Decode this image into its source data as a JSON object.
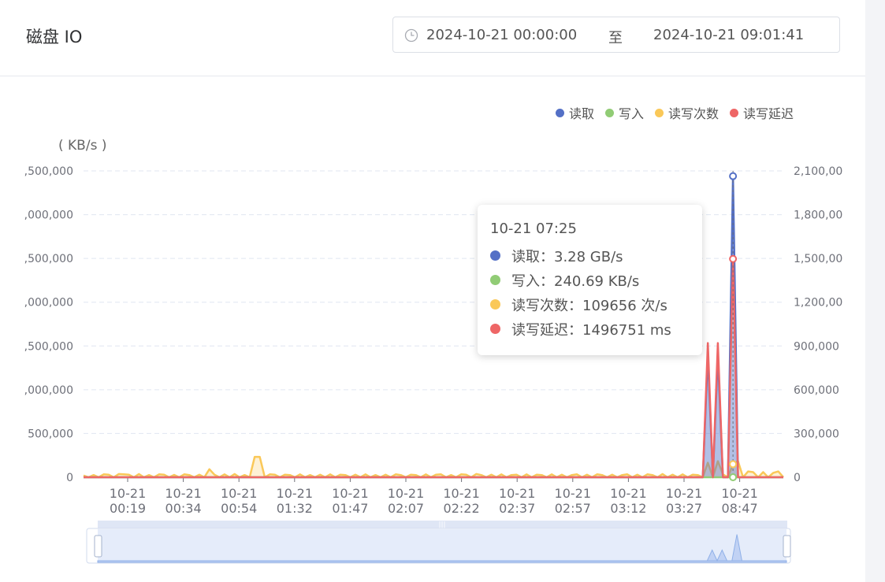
{
  "page": {
    "title": "磁盘 IO",
    "range": {
      "start": "2024-10-21 00:00:00",
      "separator": "至",
      "end": "2024-10-21 09:01:41"
    }
  },
  "legend": [
    {
      "label": "读取",
      "color": "#5470c6"
    },
    {
      "label": "写入",
      "color": "#91cc75"
    },
    {
      "label": "读写次数",
      "color": "#fac858"
    },
    {
      "label": "读写延迟",
      "color": "#ee6666"
    }
  ],
  "tooltip": {
    "title": "10-21 07:25",
    "rows": [
      {
        "label": "读取：3.28 GB/s",
        "color": "#5470c6"
      },
      {
        "label": "写入：240.69 KB/s",
        "color": "#91cc75"
      },
      {
        "label": "读写次数：109656 次/s",
        "color": "#fac858"
      },
      {
        "label": "读写延迟：1496751 ms",
        "color": "#ee6666"
      }
    ]
  },
  "chart_data": {
    "type": "line",
    "y_unit_label": "( KB/s )",
    "left_axis": {
      "ticks": [
        ",500,000",
        ",000,000",
        ",500,000",
        ",000,000",
        ",500,000",
        ",000,000",
        "500,000",
        "0"
      ],
      "range": [
        0,
        3500000
      ]
    },
    "right_axis": {
      "ticks": [
        "2,100,00",
        "1,800,00",
        "1,500,00",
        "1,200,00",
        "900,000",
        "600,000",
        "300,000",
        "0"
      ],
      "range": [
        0,
        2100000
      ]
    },
    "x_ticks": [
      {
        "line1": "10-21",
        "line2": "00:19"
      },
      {
        "line1": "10-21",
        "line2": "00:34"
      },
      {
        "line1": "10-21",
        "line2": "00:54"
      },
      {
        "line1": "10-21",
        "line2": "01:32"
      },
      {
        "line1": "10-21",
        "line2": "01:47"
      },
      {
        "line1": "10-21",
        "line2": "02:07"
      },
      {
        "line1": "10-21",
        "line2": "02:22"
      },
      {
        "line1": "10-21",
        "line2": "02:37"
      },
      {
        "line1": "10-21",
        "line2": "02:57"
      },
      {
        "line1": "10-21",
        "line2": "03:12"
      },
      {
        "line1": "10-21",
        "line2": "03:27"
      },
      {
        "line1": "10-21",
        "line2": "08:47"
      }
    ],
    "grid": true,
    "legend_position": "top-right",
    "series": [
      {
        "name": "读取",
        "axis": "left",
        "color": "#5470c6",
        "area": true,
        "values": [
          0,
          0,
          0,
          0,
          0,
          0,
          0,
          0,
          0,
          0,
          0,
          0,
          0,
          0,
          0,
          0,
          0,
          0,
          0,
          0,
          0,
          0,
          0,
          0,
          0,
          0,
          0,
          0,
          0,
          0,
          0,
          0,
          0,
          0,
          0,
          0,
          0,
          0,
          0,
          0,
          0,
          0,
          0,
          0,
          0,
          0,
          0,
          0,
          0,
          0,
          0,
          0,
          0,
          0,
          0,
          0,
          0,
          0,
          0,
          0,
          0,
          0,
          0,
          0,
          0,
          0,
          0,
          0,
          0,
          0,
          0,
          0,
          0,
          0,
          0,
          0,
          0,
          0,
          0,
          0,
          0,
          0,
          0,
          0,
          0,
          0,
          0,
          0,
          0,
          0,
          0,
          0,
          0,
          0,
          0,
          0,
          0,
          0,
          0,
          0,
          0,
          0,
          0,
          0,
          0,
          0,
          0,
          0,
          0,
          0,
          0,
          0,
          0,
          0,
          0,
          0,
          0,
          0,
          0,
          0,
          0,
          0,
          0,
          0,
          1400000,
          0,
          1400000,
          0,
          0,
          3440000,
          0,
          0,
          0,
          0,
          0,
          0,
          0,
          0,
          0,
          0
        ]
      },
      {
        "name": "写入",
        "axis": "left",
        "color": "#91cc75",
        "area": false,
        "values": [
          0,
          0,
          0,
          0,
          0,
          0,
          0,
          0,
          0,
          0,
          0,
          0,
          0,
          0,
          0,
          0,
          0,
          0,
          0,
          0,
          0,
          0,
          0,
          0,
          0,
          0,
          0,
          0,
          0,
          0,
          0,
          0,
          0,
          0,
          0,
          0,
          0,
          0,
          0,
          0,
          0,
          0,
          0,
          0,
          0,
          0,
          0,
          0,
          0,
          0,
          0,
          0,
          0,
          0,
          0,
          0,
          0,
          0,
          0,
          0,
          0,
          0,
          0,
          0,
          0,
          0,
          0,
          0,
          0,
          0,
          0,
          0,
          0,
          0,
          0,
          0,
          0,
          0,
          0,
          0,
          0,
          0,
          0,
          0,
          0,
          0,
          0,
          0,
          0,
          0,
          0,
          0,
          0,
          0,
          0,
          0,
          0,
          0,
          0,
          0,
          0,
          0,
          0,
          0,
          0,
          0,
          0,
          0,
          0,
          0,
          0,
          0,
          0,
          0,
          0,
          0,
          0,
          0,
          0,
          0,
          0,
          0,
          0,
          0,
          0,
          0,
          0,
          0,
          0,
          0,
          0,
          0,
          0,
          0,
          0,
          0,
          0,
          0,
          0,
          0
        ]
      },
      {
        "name": "读写次数",
        "axis": "right",
        "color": "#fac858",
        "area": true,
        "values": [
          12000,
          0,
          15000,
          0,
          20000,
          18000,
          0,
          22000,
          20000,
          18000,
          0,
          22000,
          0,
          15000,
          0,
          20000,
          18000,
          0,
          16000,
          0,
          20000,
          15000,
          0,
          18000,
          0,
          55000,
          18000,
          0,
          20000,
          0,
          22000,
          0,
          15000,
          0,
          140000,
          140000,
          0,
          20000,
          18000,
          0,
          18000,
          15000,
          0,
          20000,
          0,
          15000,
          0,
          18000,
          0,
          20000,
          0,
          18000,
          15000,
          0,
          18000,
          0,
          20000,
          0,
          15000,
          0,
          18000,
          0,
          20000,
          15000,
          0,
          18000,
          15000,
          0,
          20000,
          0,
          18000,
          20000,
          0,
          15000,
          0,
          20000,
          18000,
          0,
          22000,
          15000,
          0,
          18000,
          0,
          20000,
          0,
          15000,
          18000,
          0,
          20000,
          0,
          18000,
          15000,
          0,
          20000,
          0,
          18000,
          0,
          15000,
          20000,
          0,
          18000,
          0,
          20000,
          15000,
          0,
          18000,
          0,
          15000,
          20000,
          0,
          18000,
          0,
          20000,
          15000,
          0,
          22000,
          0,
          18000,
          0,
          20000,
          0,
          18000,
          15000,
          0,
          100000,
          0,
          110000,
          20000,
          0,
          90000,
          110000,
          0,
          40000,
          35000,
          0,
          35000,
          0,
          30000,
          40000,
          0
        ]
      },
      {
        "name": "读写延迟",
        "axis": "right",
        "color": "#ee6666",
        "area": false,
        "values": [
          0,
          0,
          0,
          0,
          0,
          0,
          0,
          0,
          0,
          0,
          0,
          0,
          0,
          0,
          0,
          0,
          0,
          0,
          0,
          0,
          0,
          0,
          0,
          0,
          0,
          0,
          0,
          0,
          0,
          0,
          0,
          0,
          0,
          0,
          0,
          0,
          0,
          0,
          0,
          0,
          0,
          0,
          0,
          0,
          0,
          0,
          0,
          0,
          0,
          0,
          0,
          0,
          0,
          0,
          0,
          0,
          0,
          0,
          0,
          0,
          0,
          0,
          0,
          0,
          0,
          0,
          0,
          0,
          0,
          0,
          0,
          0,
          0,
          0,
          0,
          0,
          0,
          0,
          0,
          0,
          0,
          0,
          0,
          0,
          0,
          0,
          0,
          0,
          0,
          0,
          0,
          0,
          0,
          0,
          0,
          0,
          0,
          0,
          0,
          0,
          0,
          0,
          0,
          0,
          0,
          0,
          0,
          0,
          0,
          0,
          0,
          0,
          0,
          0,
          0,
          0,
          0,
          0,
          0,
          0,
          0,
          0,
          0,
          0,
          920000,
          0,
          920000,
          0,
          0,
          1496751,
          0,
          0,
          0,
          0,
          0,
          0,
          0,
          0,
          0,
          0
        ]
      }
    ],
    "highlight_index": 129
  }
}
